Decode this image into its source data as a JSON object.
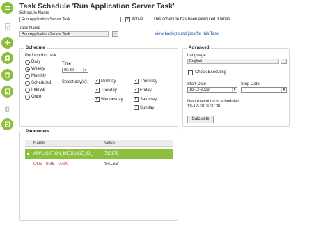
{
  "title": "Task Schedule 'Run Application Server Task'",
  "schedule_name": {
    "label": "Schedule Name",
    "value": "Run Application Server Task"
  },
  "active": {
    "label": "Active",
    "checked": true
  },
  "executed_text": "This schedule has been executed 3 times.",
  "task_name": {
    "label": "Task Name",
    "value": "Run Application Server Task",
    "button": "..."
  },
  "background_link": "View background jobs for this Task",
  "schedule": {
    "title": "Schedule",
    "perform_label": "Perform this task:",
    "options": [
      "Daily",
      "Weekly",
      "Monthly",
      "Scheduled",
      "Interval",
      "Once"
    ],
    "selected": "Weekly",
    "time_label": "Time",
    "time_value": "00:30",
    "days_label": "Select day(s):",
    "days_col1": [
      {
        "name": "Monday",
        "checked": true
      },
      {
        "name": "Tuesday",
        "checked": true
      },
      {
        "name": "Wednesday",
        "checked": true
      }
    ],
    "days_col2": [
      {
        "name": "Thursday",
        "checked": true
      },
      {
        "name": "Friday",
        "checked": true
      },
      {
        "name": "Saturday",
        "checked": true
      },
      {
        "name": "Sunday",
        "checked": true
      }
    ]
  },
  "advanced": {
    "title": "Advanced",
    "language_label": "Language",
    "language_value": "English",
    "language_button": "...",
    "check_executing": {
      "label": "Check Executing",
      "checked": false
    },
    "start_label": "Start Date",
    "start_value": "16-12-2019",
    "stop_label": "Stop Date",
    "stop_value": "",
    "next_exec_line1": "Next execution is scheduled",
    "next_exec_line2": "19-12-2019 00:30",
    "calculate": "Calculate"
  },
  "parameters": {
    "title": "Parameters",
    "columns": [
      "Name",
      "Value"
    ],
    "rows": [
      {
        "name": "APPLICATION_MESSAGE_ID_",
        "value": "715176",
        "selected": true
      },
      {
        "name": "ONE_TIME_TASK_",
        "value": "'FALSE'",
        "selected": false
      }
    ]
  },
  "colors": {
    "accent_green": "#8bbf3a",
    "row_selected": "#8cbf3c",
    "param_red": "#c83030",
    "link_blue": "#1a4fa0"
  }
}
